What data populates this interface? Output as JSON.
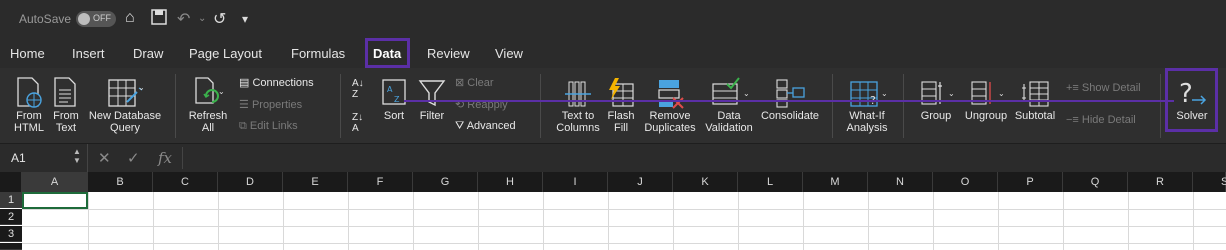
{
  "titlebar": {
    "autosave": "AutoSave",
    "toggle": "OFF"
  },
  "tabs": [
    "Home",
    "Insert",
    "Draw",
    "Page Layout",
    "Formulas",
    "Data",
    "Review",
    "View"
  ],
  "ribbon": {
    "from_html": [
      "From",
      "HTML"
    ],
    "from_text": [
      "From",
      "Text"
    ],
    "new_db_query": [
      "New Database",
      "Query"
    ],
    "refresh_all": [
      "Refresh",
      "All"
    ],
    "connections": "Connections",
    "properties": "Properties",
    "edit_links": "Edit Links",
    "sort": "Sort",
    "filter": "Filter",
    "clear": "Clear",
    "reapply": "Reapply",
    "advanced": "Advanced",
    "text_to_columns": [
      "Text to",
      "Columns"
    ],
    "flash_fill": [
      "Flash",
      "Fill"
    ],
    "remove_duplicates": [
      "Remove",
      "Duplicates"
    ],
    "data_validation": [
      "Data",
      "Validation"
    ],
    "consolidate": "Consolidate",
    "what_if": [
      "What-If",
      "Analysis"
    ],
    "group": "Group",
    "ungroup": "Ungroup",
    "subtotal": "Subtotal",
    "show_detail": "Show Detail",
    "hide_detail": "Hide Detail",
    "solver": "Solver"
  },
  "formula": {
    "namebox": "A1",
    "fx": "fx"
  },
  "columns": [
    "A",
    "B",
    "C",
    "D",
    "E",
    "F",
    "G",
    "H",
    "I",
    "J",
    "K",
    "L",
    "M",
    "N",
    "O",
    "P",
    "Q",
    "R",
    "S"
  ],
  "rows": [
    "1",
    "2",
    "3"
  ],
  "colors": {
    "highlight": "#5b2fa6",
    "selection": "#1e6b3a"
  }
}
